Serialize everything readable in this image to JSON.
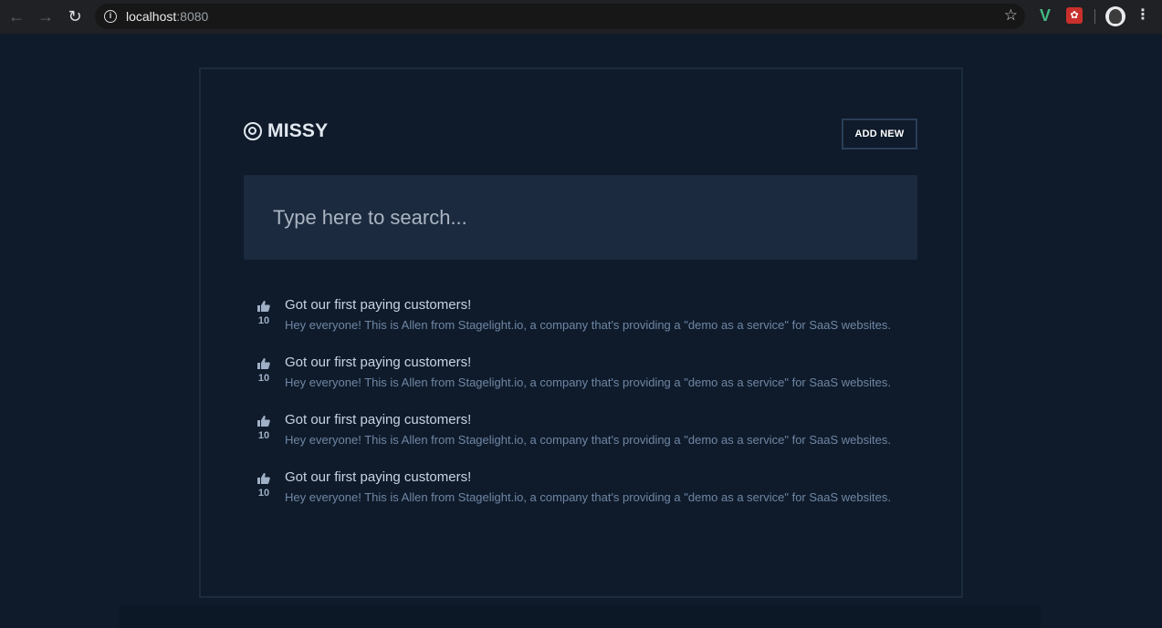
{
  "browser": {
    "url_host": "localhost",
    "url_port": ":8080",
    "icons": {
      "back": "arrow-left-icon",
      "forward": "arrow-right-icon",
      "reload": "reload-icon",
      "info": "info-icon",
      "bookmark": "star-icon",
      "menu": "kebab-menu-icon"
    },
    "extensions": [
      {
        "name": "vue-devtools-icon",
        "glyph": "V",
        "color": "#41b883"
      },
      {
        "name": "red-extension-icon",
        "glyph": "✿",
        "color": "#c9302c"
      }
    ]
  },
  "header": {
    "brand": "MISSY",
    "brand_icon": "target-icon",
    "add_button": "ADD NEW"
  },
  "search": {
    "placeholder": "Type here to search..."
  },
  "posts": [
    {
      "votes": "10",
      "title": "Got our first paying customers!",
      "body": "Hey everyone! This is Allen from Stagelight.io, a company that's providing a \"demo as a service\" for SaaS websites."
    },
    {
      "votes": "10",
      "title": "Got our first paying customers!",
      "body": "Hey everyone! This is Allen from Stagelight.io, a company that's providing a \"demo as a service\" for SaaS websites."
    },
    {
      "votes": "10",
      "title": "Got our first paying customers!",
      "body": "Hey everyone! This is Allen from Stagelight.io, a company that's providing a \"demo as a service\" for SaaS websites."
    },
    {
      "votes": "10",
      "title": "Got our first paying customers!",
      "body": "Hey everyone! This is Allen from Stagelight.io, a company that's providing a \"demo as a service\" for SaaS websites."
    }
  ],
  "colors": {
    "background": "#0f1b2b",
    "card_border": "#1c2b3d",
    "search_bg": "#1b2a3e",
    "title_text": "#c8d3e2",
    "body_text": "#6f86a3",
    "vote_text": "#9fb0c6"
  }
}
